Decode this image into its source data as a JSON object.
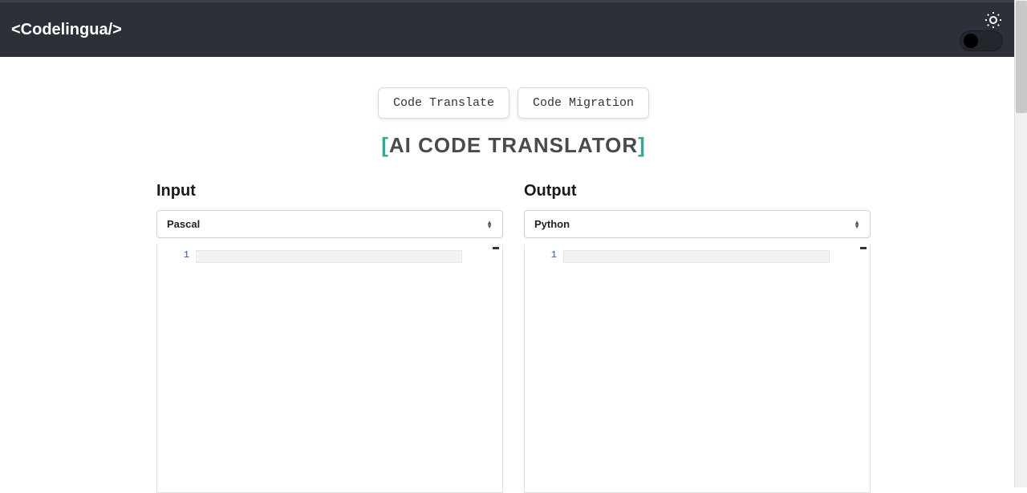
{
  "header": {
    "logo": "<Codelingua/>"
  },
  "tabs": {
    "translate": "Code Translate",
    "migration": "Code Migration"
  },
  "heading": {
    "open_bracket": "[",
    "text": "AI CODE TRANSLATOR",
    "close_bracket": "]"
  },
  "input_panel": {
    "title": "Input",
    "language": "Pascal",
    "line_number": "1"
  },
  "output_panel": {
    "title": "Output",
    "language": "Python",
    "line_number": "1"
  }
}
